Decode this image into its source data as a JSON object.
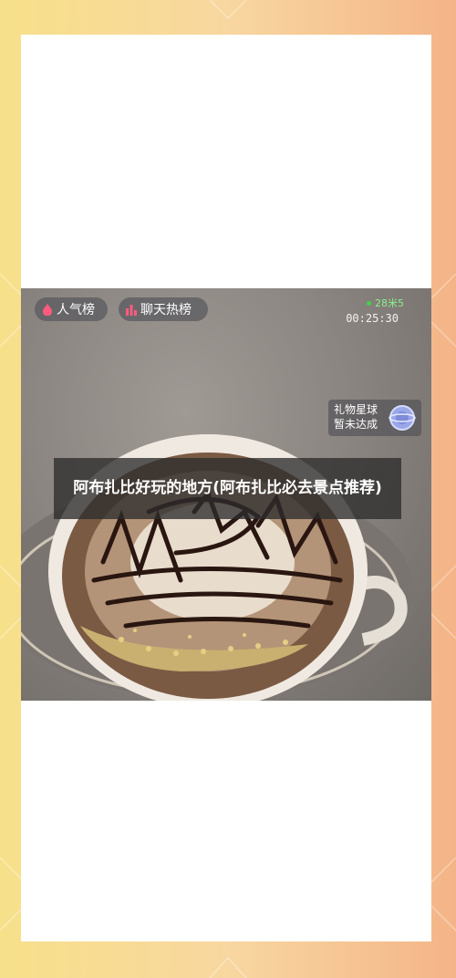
{
  "article": {
    "title": "阿布扎比好玩的地方(阿布扎比必去景点推荐)"
  },
  "live_overlay": {
    "rank_pill": {
      "label": "人气榜",
      "icon": "flame-icon"
    },
    "chat_pill": {
      "label": "聊天热榜",
      "icon": "bar-chart-icon"
    },
    "status": "28米5",
    "timer": "00:25:30",
    "gift": {
      "line1": "礼物星球",
      "line2": "暂未达成",
      "icon": "planet-icon"
    }
  },
  "colors": {
    "background_left": "#f7e08a",
    "background_right": "#f4b487",
    "card": "#ffffff",
    "title_overlay": "#2d2d2d",
    "live_green": "#3fd24a"
  }
}
